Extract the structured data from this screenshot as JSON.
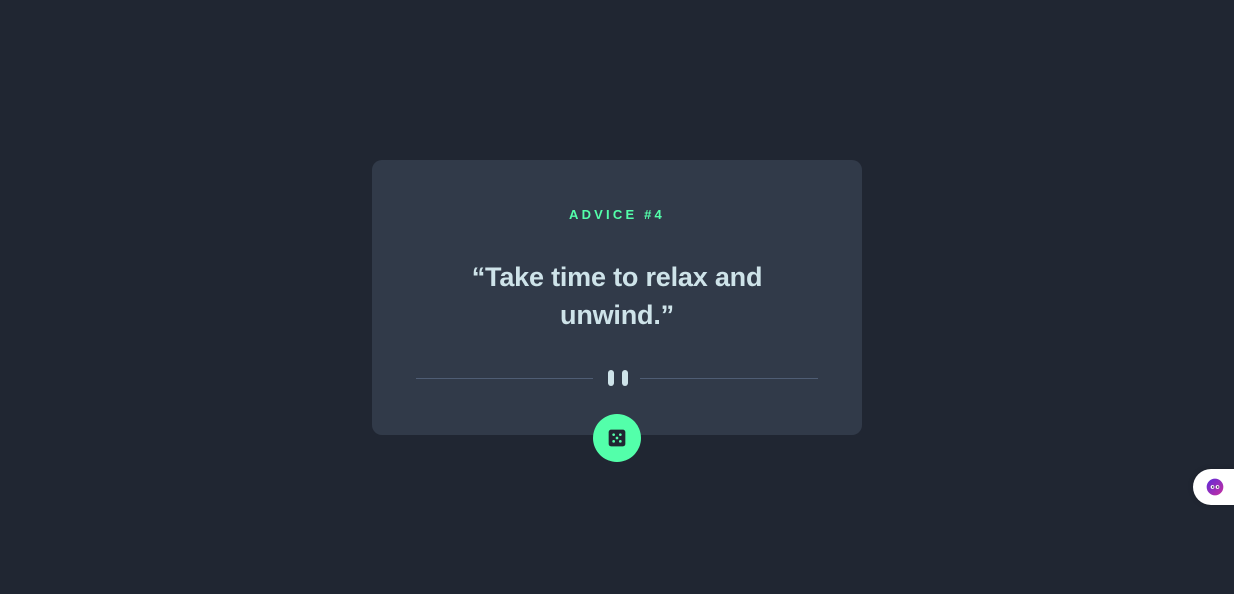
{
  "card": {
    "advice_label": "ADVICE #4",
    "quote": "“Take time to relax and unwind.”"
  },
  "divider": {
    "icon": "pause-icon"
  },
  "actions": {
    "dice_button_icon": "dice-icon"
  },
  "widget": {
    "icon": "assistant-face-icon"
  },
  "colors": {
    "background": "#202632",
    "card": "#313a49",
    "accent": "#53ffaa",
    "text": "#cee3e9",
    "divider": "#4f5d74"
  }
}
